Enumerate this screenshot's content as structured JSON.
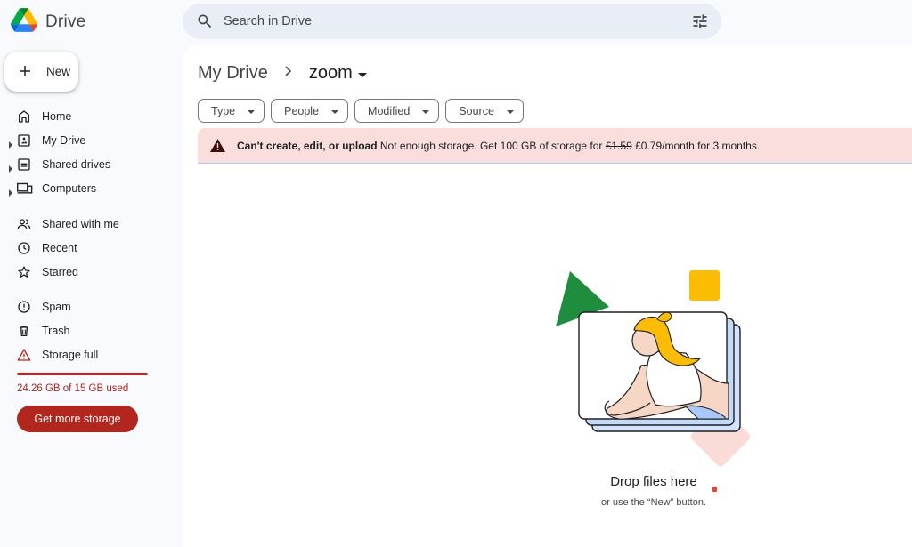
{
  "app": {
    "name": "Drive"
  },
  "search": {
    "placeholder": "Search in Drive"
  },
  "sidebar": {
    "new_label": "New",
    "items": [
      {
        "label": "Home",
        "icon": "home-icon"
      },
      {
        "label": "My Drive",
        "icon": "my-drive-icon"
      },
      {
        "label": "Shared drives",
        "icon": "shared-drives-icon"
      },
      {
        "label": "Computers",
        "icon": "computers-icon"
      },
      {
        "label": "Shared with me",
        "icon": "people-icon"
      },
      {
        "label": "Recent",
        "icon": "clock-icon"
      },
      {
        "label": "Starred",
        "icon": "star-icon"
      },
      {
        "label": "Spam",
        "icon": "spam-icon"
      },
      {
        "label": "Trash",
        "icon": "trash-icon"
      },
      {
        "label": "Storage full",
        "icon": "warning-icon"
      }
    ],
    "storage_used_fraction": 1.0,
    "storage_text": "24.26 GB of 15 GB used",
    "get_storage_label": "Get more storage"
  },
  "breadcrumb": {
    "root": "My Drive",
    "current": "zoom"
  },
  "filters": [
    "Type",
    "People",
    "Modified",
    "Source"
  ],
  "banner": {
    "title": "Can't create, edit, or upload",
    "message": "Not enough storage. Get 100 GB of storage for",
    "old_price": "£1.59",
    "new_price": "£0.79/month for 3 months."
  },
  "empty_state": {
    "title": "Drop files here",
    "subtitle": "or use the “New” button."
  },
  "colors": {
    "accent_red": "#b3261e",
    "banner_bg": "#f9dedc",
    "search_bg": "#e9eef6"
  }
}
